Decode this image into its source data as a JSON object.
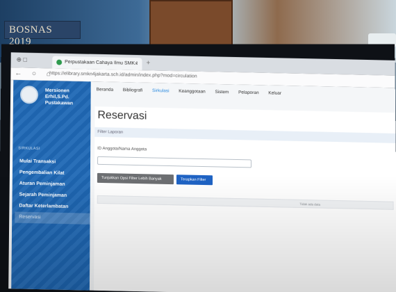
{
  "room": {
    "banner_text": "BOSNAS 2019"
  },
  "browser": {
    "tab_title": "Perpustakaan Cahaya Ilmu SMK I",
    "tab_close": "×",
    "new_tab": "+",
    "window_controls": "⊕ □",
    "nav_icons": "← ○ ⌂",
    "url": "https://elibrary.smkn4jakarta.sch.id/admin/index.php?mod=circulation"
  },
  "sidebar": {
    "user_name": "Mersionen Erhil,S.Pd.",
    "user_role": "Pustakawan",
    "section_label": "SIRKULASI",
    "items": [
      {
        "label": "Mulai Transaksi"
      },
      {
        "label": "Pengembalian Kilat"
      },
      {
        "label": "Aturan Peminjaman"
      },
      {
        "label": "Sejarah Peminjaman"
      },
      {
        "label": "Daftar Keterlambatan"
      },
      {
        "label": "Reservasi"
      }
    ]
  },
  "topnav": {
    "items": [
      {
        "label": "Beranda"
      },
      {
        "label": "Bibliografi"
      },
      {
        "label": "Sirkulasi"
      },
      {
        "label": "Keanggotaan"
      },
      {
        "label": "Sistem"
      },
      {
        "label": "Pelaporan"
      },
      {
        "label": "Keluar"
      }
    ]
  },
  "main": {
    "title": "Reservasi",
    "filter_label": "Filter Laporan",
    "field_label": "ID Anggota/Nama Anggota",
    "field_value": "",
    "more_filter_button": "Tunjukkan Opsi Filter Lebih Banyak",
    "apply_filter_button": "Terapkan Filter",
    "empty_text": "Tidak ada data"
  },
  "colors": {
    "sidebar": "#1f68b5",
    "accent": "#2a8adf",
    "apply_button": "#1f63c4"
  }
}
